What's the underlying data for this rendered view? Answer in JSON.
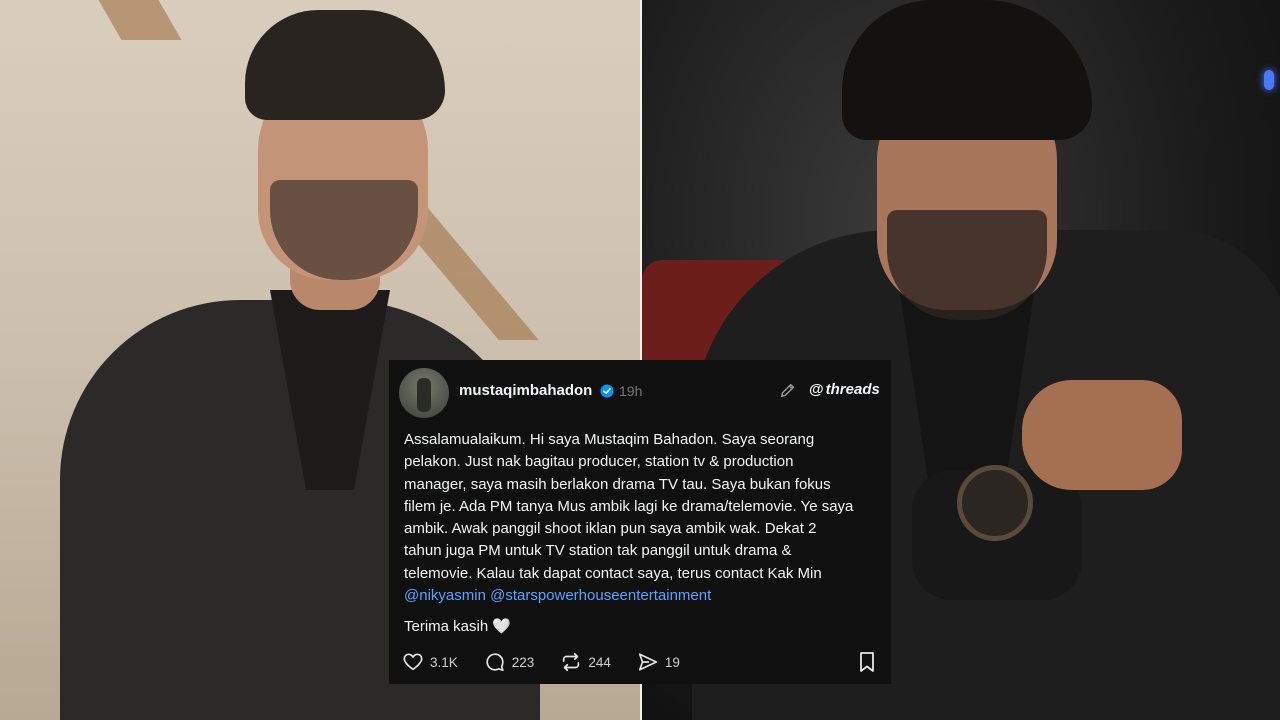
{
  "post": {
    "username": "mustaqimbahadon",
    "time": "19h",
    "brand": "threads",
    "body_lines": [
      "Assalamualaikum. Hi saya Mustaqim Bahadon. Saya seorang",
      "pelakon. Just nak bagitau producer, station tv & production",
      "manager, saya masih berlakon drama TV tau. Saya bukan fokus",
      "filem je. Ada PM tanya Mus ambik lagi ke drama/telemovie. Ye saya",
      "ambik. Awak panggil shoot iklan pun saya ambik wak. Dekat 2",
      "tahun juga PM untuk TV station tak panggil untuk drama &",
      "telemovie. Kalau tak dapat contact saya, terus contact Kak Min"
    ],
    "mentions": [
      "@nikyasmin",
      "@starspowerhouseentertainment"
    ],
    "thanks": "Terima kasih 🤍",
    "likes": "3.1K",
    "replies": "223",
    "reposts": "244",
    "shares": "19"
  },
  "colors": {
    "card_bg": "#101010",
    "mention": "#5ba3ff",
    "verified": "#0095f6",
    "text": "#f3f5f7",
    "muted": "#777777"
  },
  "icons": [
    "verified-badge-icon",
    "edit-icon",
    "threads-logo-icon",
    "heart-icon",
    "reply-icon",
    "repost-icon",
    "share-icon",
    "bookmark-icon"
  ]
}
